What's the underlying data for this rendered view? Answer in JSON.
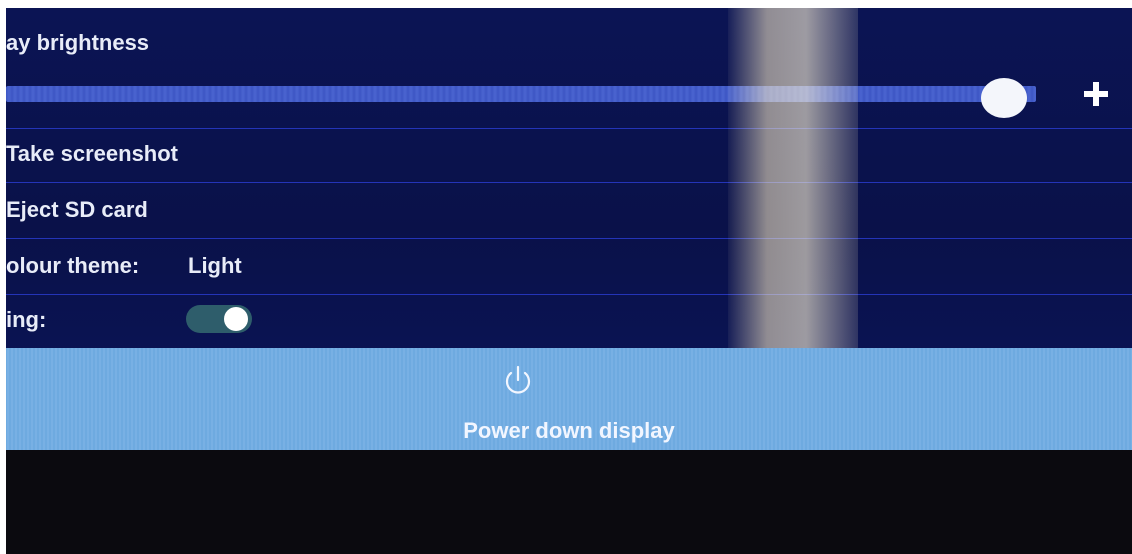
{
  "brightness": {
    "label": "ay brightness",
    "value_fraction": 0.96,
    "increase_symbol": "+"
  },
  "menu": {
    "screenshot_label": "Take screenshot",
    "eject_label": "Eject SD card",
    "theme_label": "olour theme:",
    "theme_value": "Light",
    "toggle_label": "ing:",
    "toggle_on": true
  },
  "power": {
    "label": "Power down display",
    "icon": "power-icon"
  },
  "colors": {
    "background": "#0b1454",
    "accent": "#6aa6de",
    "text": "#e8ecf8"
  }
}
